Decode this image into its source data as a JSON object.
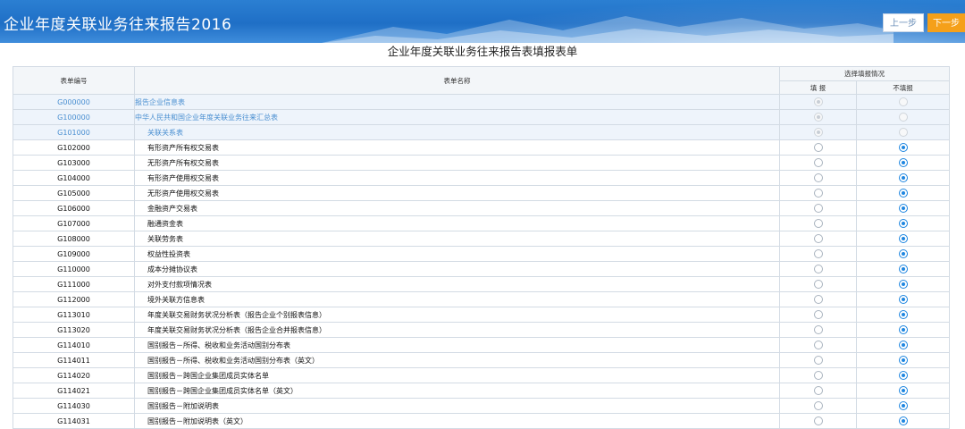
{
  "header": {
    "app_title": "企业年度关联业务往来报告2016",
    "prev_label": "上一步",
    "next_label": "下一步"
  },
  "form_title": "企业年度关联业务往来报告表填报表单",
  "table": {
    "col_code": "表单编号",
    "col_name": "表单名称",
    "col_select": "选择填报情况",
    "col_fill": "填 报",
    "col_nofill": "不填报",
    "rows": [
      {
        "code": "G000000",
        "name": "报告企业信息表",
        "state": "fill",
        "locked": true,
        "blue": true,
        "indent": false
      },
      {
        "code": "G100000",
        "name": "中华人民共和国企业年度关联业务往来汇总表",
        "state": "fill",
        "locked": true,
        "blue": true,
        "indent": false
      },
      {
        "code": "G101000",
        "name": "关联关系表",
        "state": "fill",
        "locked": true,
        "blue": true,
        "indent": true
      },
      {
        "code": "G102000",
        "name": "有形资产所有权交易表",
        "state": "nofill",
        "locked": false,
        "blue": false,
        "indent": true
      },
      {
        "code": "G103000",
        "name": "无形资产所有权交易表",
        "state": "nofill",
        "locked": false,
        "blue": false,
        "indent": true
      },
      {
        "code": "G104000",
        "name": "有形资产使用权交易表",
        "state": "nofill",
        "locked": false,
        "blue": false,
        "indent": true
      },
      {
        "code": "G105000",
        "name": "无形资产使用权交易表",
        "state": "nofill",
        "locked": false,
        "blue": false,
        "indent": true
      },
      {
        "code": "G106000",
        "name": "金融资产交易表",
        "state": "nofill",
        "locked": false,
        "blue": false,
        "indent": true
      },
      {
        "code": "G107000",
        "name": "融通资金表",
        "state": "nofill",
        "locked": false,
        "blue": false,
        "indent": true
      },
      {
        "code": "G108000",
        "name": "关联劳务表",
        "state": "nofill",
        "locked": false,
        "blue": false,
        "indent": true
      },
      {
        "code": "G109000",
        "name": "权益性投资表",
        "state": "nofill",
        "locked": false,
        "blue": false,
        "indent": true
      },
      {
        "code": "G110000",
        "name": "成本分摊协议表",
        "state": "nofill",
        "locked": false,
        "blue": false,
        "indent": true
      },
      {
        "code": "G111000",
        "name": "对外支付款项情况表",
        "state": "nofill",
        "locked": false,
        "blue": false,
        "indent": true
      },
      {
        "code": "G112000",
        "name": "境外关联方信息表",
        "state": "nofill",
        "locked": false,
        "blue": false,
        "indent": true
      },
      {
        "code": "G113010",
        "name": "年度关联交易财务状况分析表（报告企业个别报表信息）",
        "state": "nofill",
        "locked": false,
        "blue": false,
        "indent": true
      },
      {
        "code": "G113020",
        "name": "年度关联交易财务状况分析表（报告企业合并报表信息）",
        "state": "nofill",
        "locked": false,
        "blue": false,
        "indent": true
      },
      {
        "code": "G114010",
        "name": "国别报告－所得、税收和业务活动国别分布表",
        "state": "nofill",
        "locked": false,
        "blue": false,
        "indent": true
      },
      {
        "code": "G114011",
        "name": "国别报告－所得、税收和业务活动国别分布表（英文）",
        "state": "nofill",
        "locked": false,
        "blue": false,
        "indent": true
      },
      {
        "code": "G114020",
        "name": "国别报告－跨国企业集团成员实体名单",
        "state": "nofill",
        "locked": false,
        "blue": false,
        "indent": true
      },
      {
        "code": "G114021",
        "name": "国别报告－跨国企业集团成员实体名单（英文）",
        "state": "nofill",
        "locked": false,
        "blue": false,
        "indent": true
      },
      {
        "code": "G114030",
        "name": "国别报告－附加说明表",
        "state": "nofill",
        "locked": false,
        "blue": false,
        "indent": true
      },
      {
        "code": "G114031",
        "name": "国别报告－附加说明表（英文）",
        "state": "nofill",
        "locked": false,
        "blue": false,
        "indent": true
      }
    ]
  },
  "colors": {
    "header_blue": "#1f6fc6",
    "next_button": "#f5a01a",
    "link_blue": "#4a8fd1",
    "radio_checked": "#1e86e0"
  }
}
